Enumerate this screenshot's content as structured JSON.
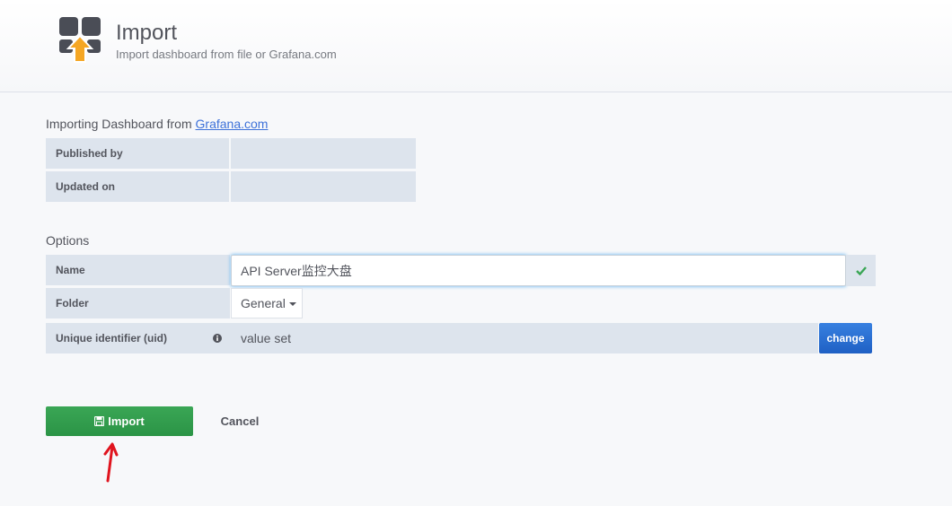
{
  "header": {
    "title": "Import",
    "subtitle": "Import dashboard from file or Grafana.com",
    "icon": "dashboard-import-icon"
  },
  "source": {
    "prefix": "Importing Dashboard from ",
    "link_label": "Grafana.com"
  },
  "info": {
    "published_by_label": "Published by",
    "published_by_value": "",
    "updated_on_label": "Updated on",
    "updated_on_value": ""
  },
  "options": {
    "heading": "Options",
    "name_label": "Name",
    "name_value": "API Server监控大盘",
    "name_valid_icon": "check-icon",
    "folder_label": "Folder",
    "folder_value": "General",
    "uid_label": "Unique identifier (uid)",
    "uid_info_icon": "info-circle-icon",
    "uid_value": "value set",
    "change_label": "change"
  },
  "actions": {
    "import_label": "Import",
    "import_icon": "save-icon",
    "cancel_label": "Cancel"
  },
  "colors": {
    "primary_button": "#2b9446",
    "secondary_button": "#1f60c4",
    "link": "#3d71d9",
    "annotation_arrow": "#e0141e",
    "valid_check": "#3aa655",
    "logo_arrow": "#f5a623"
  }
}
